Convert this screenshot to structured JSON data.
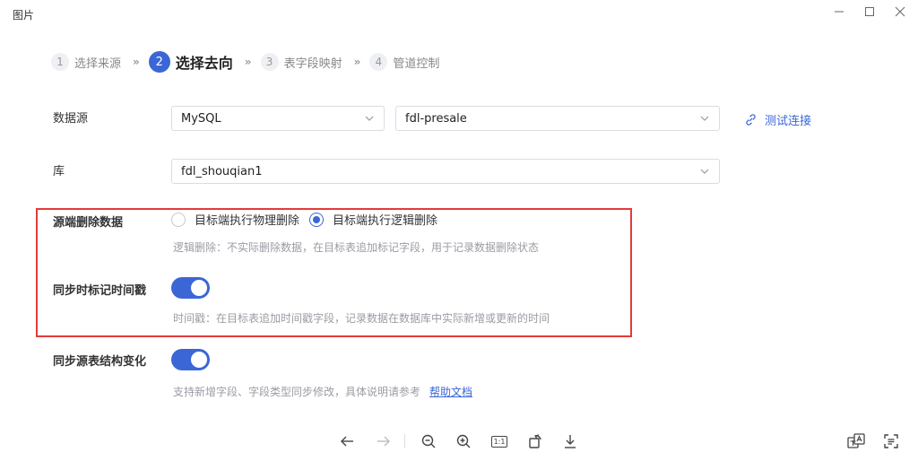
{
  "window": {
    "title": "图片"
  },
  "steps": [
    {
      "num": "1",
      "label": "选择来源",
      "active": false
    },
    {
      "num": "2",
      "label": "选择去向",
      "active": true
    },
    {
      "num": "3",
      "label": "表字段映射",
      "active": false
    },
    {
      "num": "4",
      "label": "管道控制",
      "active": false
    }
  ],
  "step_separator": "»",
  "form": {
    "datasource_label": "数据源",
    "datasource_type": "MySQL",
    "datasource_conn": "fdl-presale",
    "test_connection": "测试连接",
    "db_label": "库",
    "db_value": "fdl_shouqian1",
    "delete_label": "源端删除数据",
    "delete_option_physical": "目标端执行物理删除",
    "delete_option_logical": "目标端执行逻辑删除",
    "delete_selected": "logical",
    "delete_hint": "逻辑删除：不实际删除数据，在目标表追加标记字段，用于记录数据删除状态",
    "timestamp_label": "同步时标记时间戳",
    "timestamp_enabled": true,
    "timestamp_hint": "时间戳：在目标表追加时间戳字段，记录数据在数据库中实际新增或更新的时间",
    "schema_label": "同步源表结构变化",
    "schema_enabled": true,
    "schema_hint": "支持新增字段、字段类型同步修改，具体说明请参考",
    "schema_help_link": "帮助文档"
  },
  "toolbar": {
    "zoom_actual_label": "1:1"
  },
  "colors": {
    "accent": "#3b66d6",
    "highlight_border": "#e23b3b"
  }
}
